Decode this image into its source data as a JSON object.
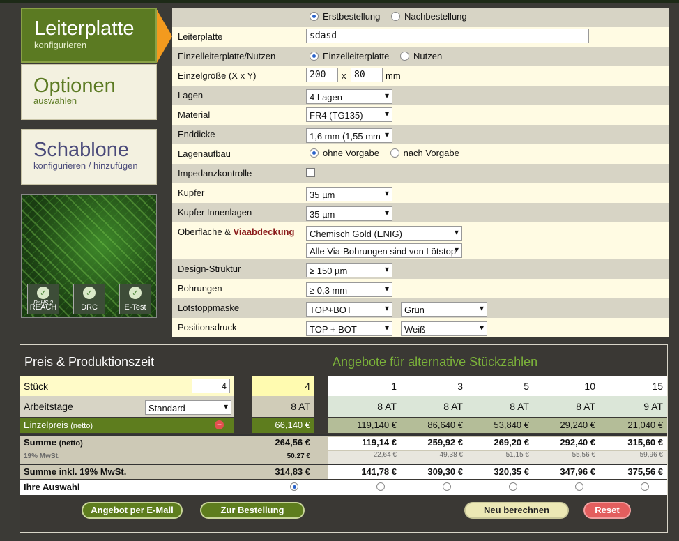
{
  "nav": {
    "item1": {
      "title": "Leiterplatte",
      "sub": "konfigurieren"
    },
    "item2": {
      "title": "Optionen",
      "sub": "auswählen"
    },
    "item3": {
      "title": "Schablone",
      "sub": "konfigurieren / hinzufügen"
    }
  },
  "badges": [
    {
      "icon": "check-icon",
      "label": "REACH",
      "extra": "RoHS 2"
    },
    {
      "icon": "check-icon",
      "label": "DRC"
    },
    {
      "icon": "check-icon",
      "label": "E-Test"
    }
  ],
  "form": {
    "order_type": {
      "opt1": "Erstbestellung",
      "opt2": "Nachbestellung",
      "selected": "Erstbestellung"
    },
    "leiterplatte": {
      "label": "Leiterplatte",
      "value": "sdasd"
    },
    "einzel": {
      "label": "Einzelleiterplatte/Nutzen",
      "opt1": "Einzelleiterplatte",
      "opt2": "Nutzen",
      "selected": "Einzelleiterplatte"
    },
    "groesse": {
      "label": "Einzelgröße (X x Y)",
      "x": "200",
      "sep": "x",
      "y": "80",
      "unit": "mm"
    },
    "lagen": {
      "label": "Lagen",
      "value": "4 Lagen"
    },
    "material": {
      "label": "Material",
      "value": "FR4 (TG135)"
    },
    "enddicke": {
      "label": "Enddicke",
      "value": "1,6 mm (1,55 mm"
    },
    "lagenaufbau": {
      "label": "Lagenaufbau",
      "opt1": "ohne Vorgabe",
      "opt2": "nach Vorgabe",
      "selected": "ohne Vorgabe"
    },
    "impedanz": {
      "label": "Impedanzkontrolle",
      "checked": false
    },
    "kupfer": {
      "label": "Kupfer",
      "value": "35 µm"
    },
    "kupfer_innen": {
      "label": "Kupfer Innenlagen",
      "value": "35 µm"
    },
    "oberflaeche": {
      "label": "Oberfläche &",
      "label_red": "Viaabdeckung",
      "value1": "Chemisch Gold (ENIG)",
      "value2": "Alle Via-Bohrungen sind von Lötstop"
    },
    "design": {
      "label": "Design-Struktur",
      "value": "≥ 150 µm"
    },
    "bohrungen": {
      "label": "Bohrungen",
      "value": "≥ 0,3 mm"
    },
    "loetstopp": {
      "label": "Lötstoppmaske",
      "value1": "TOP+BOT",
      "value2": "Grün"
    },
    "positionsdruck": {
      "label": "Positionsdruck",
      "value1": "TOP + BOT",
      "value2": "Weiß"
    }
  },
  "price": {
    "title": "Preis & Produktionszeit",
    "alt_title": "Angebote für alternative Stückzahlen",
    "stueck_label": "Stück",
    "stueck_value": "4",
    "arbeitstage_label": "Arbeitstage",
    "arbeitstage_value": "Standard",
    "einzelpreis_label": "Einzelpreis",
    "einzelpreis_suffix": "(netto)",
    "summe_label": "Summe",
    "summe_suffix": "(netto)",
    "mwst_label": "19% MwSt.",
    "summe_inkl_label": "Summe inkl. 19% MwSt.",
    "auswahl_label": "Ihre Auswahl",
    "main": {
      "qty": "4",
      "days": "8 AT",
      "unit": "66,140 €",
      "sum": "264,56 €",
      "tax": "50,27 €",
      "total": "314,83 €"
    },
    "alternatives": [
      {
        "qty": "1",
        "days": "8 AT",
        "unit": "119,140 €",
        "sum": "119,14 €",
        "tax": "22,64 €",
        "total": "141,78 €"
      },
      {
        "qty": "3",
        "days": "8 AT",
        "unit": "86,640 €",
        "sum": "259,92 €",
        "tax": "49,38 €",
        "total": "309,30 €"
      },
      {
        "qty": "5",
        "days": "8 AT",
        "unit": "53,840 €",
        "sum": "269,20 €",
        "tax": "51,15 €",
        "total": "320,35 €"
      },
      {
        "qty": "10",
        "days": "8 AT",
        "unit": "29,240 €",
        "sum": "292,40 €",
        "tax": "55,56 €",
        "total": "347,96 €"
      },
      {
        "qty": "15",
        "days": "9 AT",
        "unit": "21,040 €",
        "sum": "315,60 €",
        "tax": "59,96 €",
        "total": "375,56 €"
      }
    ],
    "buttons": {
      "email": "Angebot per E-Mail",
      "order": "Zur Bestellung",
      "recalc": "Neu berechnen",
      "reset": "Reset"
    }
  }
}
